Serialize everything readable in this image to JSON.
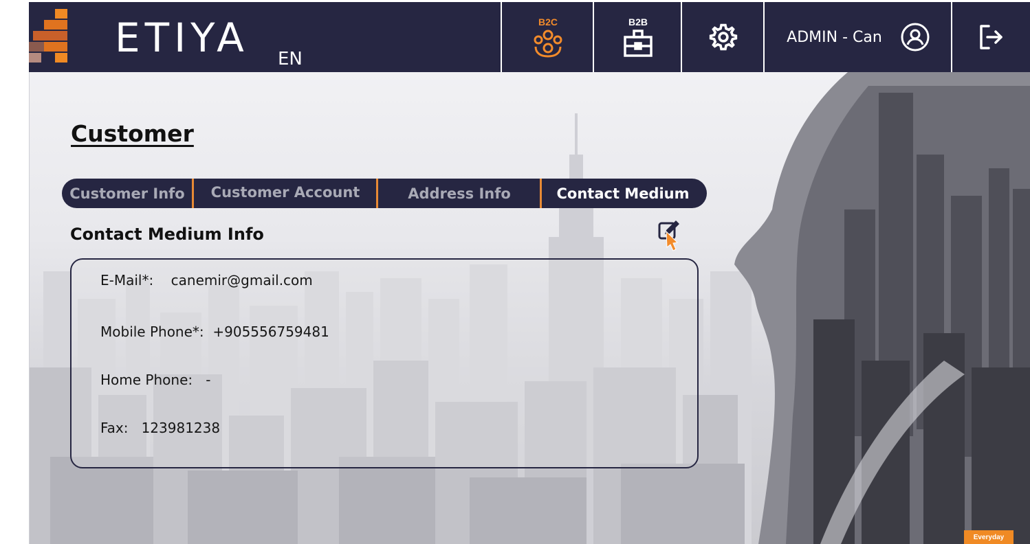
{
  "header": {
    "brand": "ETIYA",
    "language": "EN",
    "b2c_label": "B2C",
    "b2b_label": "B2B",
    "user_name": "ADMIN - Can",
    "accent_color": "#f28b2b",
    "bar_color": "#262642",
    "icons": [
      "people-group-icon",
      "briefcase-icon",
      "gear-icon",
      "user-circle-icon",
      "logout-icon"
    ]
  },
  "page": {
    "title": "Customer"
  },
  "tabs": [
    {
      "label": "Customer Info",
      "active": false
    },
    {
      "label": "Customer Account",
      "active": false
    },
    {
      "label": "Address Info",
      "active": false
    },
    {
      "label": "Contact Medium",
      "active": true
    }
  ],
  "contact": {
    "section_title": "Contact Medium Info",
    "email_label": "E-Mail*:",
    "email_value": "canemir@gmail.com",
    "mobile_label": "Mobile Phone*:",
    "mobile_value": "+905556759481",
    "home_label": "Home Phone:",
    "home_value": "-",
    "fax_label": "Fax:",
    "fax_value": "123981238"
  },
  "footer_badge": "Everyday"
}
